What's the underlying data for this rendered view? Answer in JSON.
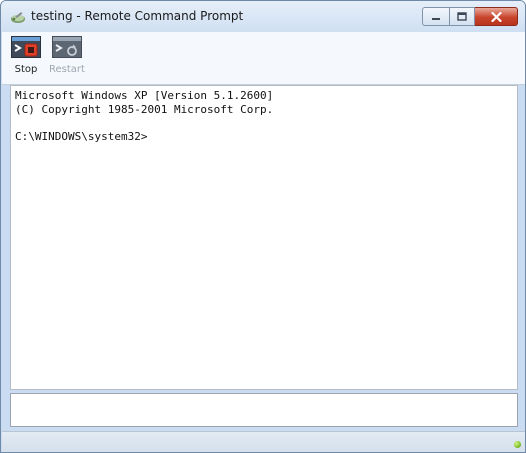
{
  "window": {
    "title": "testing - Remote Command Prompt"
  },
  "toolbar": {
    "stop_label": "Stop",
    "restart_label": "Restart"
  },
  "console": {
    "lines": [
      "Microsoft Windows XP [Version 5.1.2600]",
      "(C) Copyright 1985-2001 Microsoft Corp.",
      "",
      "C:\\WINDOWS\\system32>"
    ]
  },
  "input": {
    "value": ""
  },
  "icons": {
    "app": "remote-console-icon",
    "stop": "stop-console-icon",
    "restart": "restart-console-icon",
    "status": "connection-status-icon"
  },
  "colors": {
    "close_button": "#c8442c",
    "stop_square": "#e0402a",
    "status_ok": "#7fc02a"
  }
}
